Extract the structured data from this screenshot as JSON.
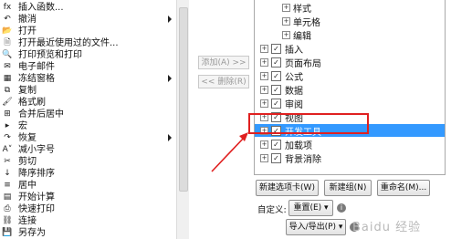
{
  "left_commands": [
    {
      "label": "插入函数...",
      "icon": "function-icon",
      "glyph": "fx",
      "submenu": false
    },
    {
      "label": "撤消",
      "icon": "undo-icon",
      "glyph": "↶",
      "submenu": true
    },
    {
      "label": "打开",
      "icon": "open-folder-icon",
      "glyph": "📂",
      "submenu": false
    },
    {
      "label": "打开最近使用过的文件...",
      "icon": "recent-file-icon",
      "glyph": "🗎",
      "submenu": false
    },
    {
      "label": "打印预览和打印",
      "icon": "print-preview-icon",
      "glyph": "🔍",
      "submenu": false
    },
    {
      "label": "电子邮件",
      "icon": "email-icon",
      "glyph": "✉",
      "submenu": false
    },
    {
      "label": "冻结窗格",
      "icon": "freeze-panes-icon",
      "glyph": "▦",
      "submenu": true
    },
    {
      "label": "复制",
      "icon": "copy-icon",
      "glyph": "⧉",
      "submenu": false
    },
    {
      "label": "格式刷",
      "icon": "format-painter-icon",
      "glyph": "🖌",
      "submenu": false
    },
    {
      "label": "合并后居中",
      "icon": "merge-center-icon",
      "glyph": "⊞",
      "submenu": false
    },
    {
      "label": "宏",
      "icon": "macro-icon",
      "glyph": "▸",
      "submenu": false
    },
    {
      "label": "恢复",
      "icon": "redo-icon",
      "glyph": "↷",
      "submenu": true
    },
    {
      "label": "减小字号",
      "icon": "decrease-font-icon",
      "glyph": "A˅",
      "submenu": false
    },
    {
      "label": "剪切",
      "icon": "cut-icon",
      "glyph": "✂",
      "submenu": false
    },
    {
      "label": "降序排序",
      "icon": "sort-descending-icon",
      "glyph": "↓",
      "submenu": false
    },
    {
      "label": "居中",
      "icon": "center-align-icon",
      "glyph": "≡",
      "submenu": false
    },
    {
      "label": "开始计算",
      "icon": "calculate-icon",
      "glyph": "▤",
      "submenu": false
    },
    {
      "label": "快速打印",
      "icon": "quick-print-icon",
      "glyph": "⎙",
      "submenu": false
    },
    {
      "label": "连接",
      "icon": "connections-icon",
      "glyph": "⛓",
      "submenu": false
    },
    {
      "label": "另存为",
      "icon": "save-as-icon",
      "glyph": "💾",
      "submenu": false
    }
  ],
  "middle": {
    "add_label": "添加(A) >>",
    "remove_label": "<< 删除(R)"
  },
  "tree": [
    {
      "label": "样式",
      "indent": 2,
      "expander": "+",
      "checkbox": false,
      "checked": false,
      "selected": false
    },
    {
      "label": "单元格",
      "indent": 2,
      "expander": "+",
      "checkbox": false,
      "checked": false,
      "selected": false
    },
    {
      "label": "编辑",
      "indent": 2,
      "expander": "+",
      "checkbox": false,
      "checked": false,
      "selected": false
    },
    {
      "label": "插入",
      "indent": 0,
      "expander": "+",
      "checkbox": true,
      "checked": true,
      "selected": false
    },
    {
      "label": "页面布局",
      "indent": 0,
      "expander": "+",
      "checkbox": true,
      "checked": true,
      "selected": false
    },
    {
      "label": "公式",
      "indent": 0,
      "expander": "+",
      "checkbox": true,
      "checked": true,
      "selected": false
    },
    {
      "label": "数据",
      "indent": 0,
      "expander": "+",
      "checkbox": true,
      "checked": true,
      "selected": false
    },
    {
      "label": "审阅",
      "indent": 0,
      "expander": "+",
      "checkbox": true,
      "checked": true,
      "selected": false
    },
    {
      "label": "视图",
      "indent": 0,
      "expander": "+",
      "checkbox": true,
      "checked": true,
      "selected": false
    },
    {
      "label": "开发工具",
      "indent": 0,
      "expander": "+",
      "checkbox": true,
      "checked": true,
      "selected": true
    },
    {
      "label": "加载项",
      "indent": 0,
      "expander": "+",
      "checkbox": true,
      "checked": true,
      "selected": false
    },
    {
      "label": "背景消除",
      "indent": 0,
      "expander": "+",
      "checkbox": true,
      "checked": true,
      "selected": false
    }
  ],
  "buttons": {
    "new_tab": "新建选项卡(W)",
    "new_group": "新建组(N)",
    "rename": "重命名(M)...",
    "customize_label": "自定义:",
    "reset": "重置(E) ▾",
    "import_export": "导入/导出(P) ▾"
  },
  "watermark": "Baidu 经验",
  "colors": {
    "highlight_box": "#e02020",
    "selection": "#3399ff"
  }
}
